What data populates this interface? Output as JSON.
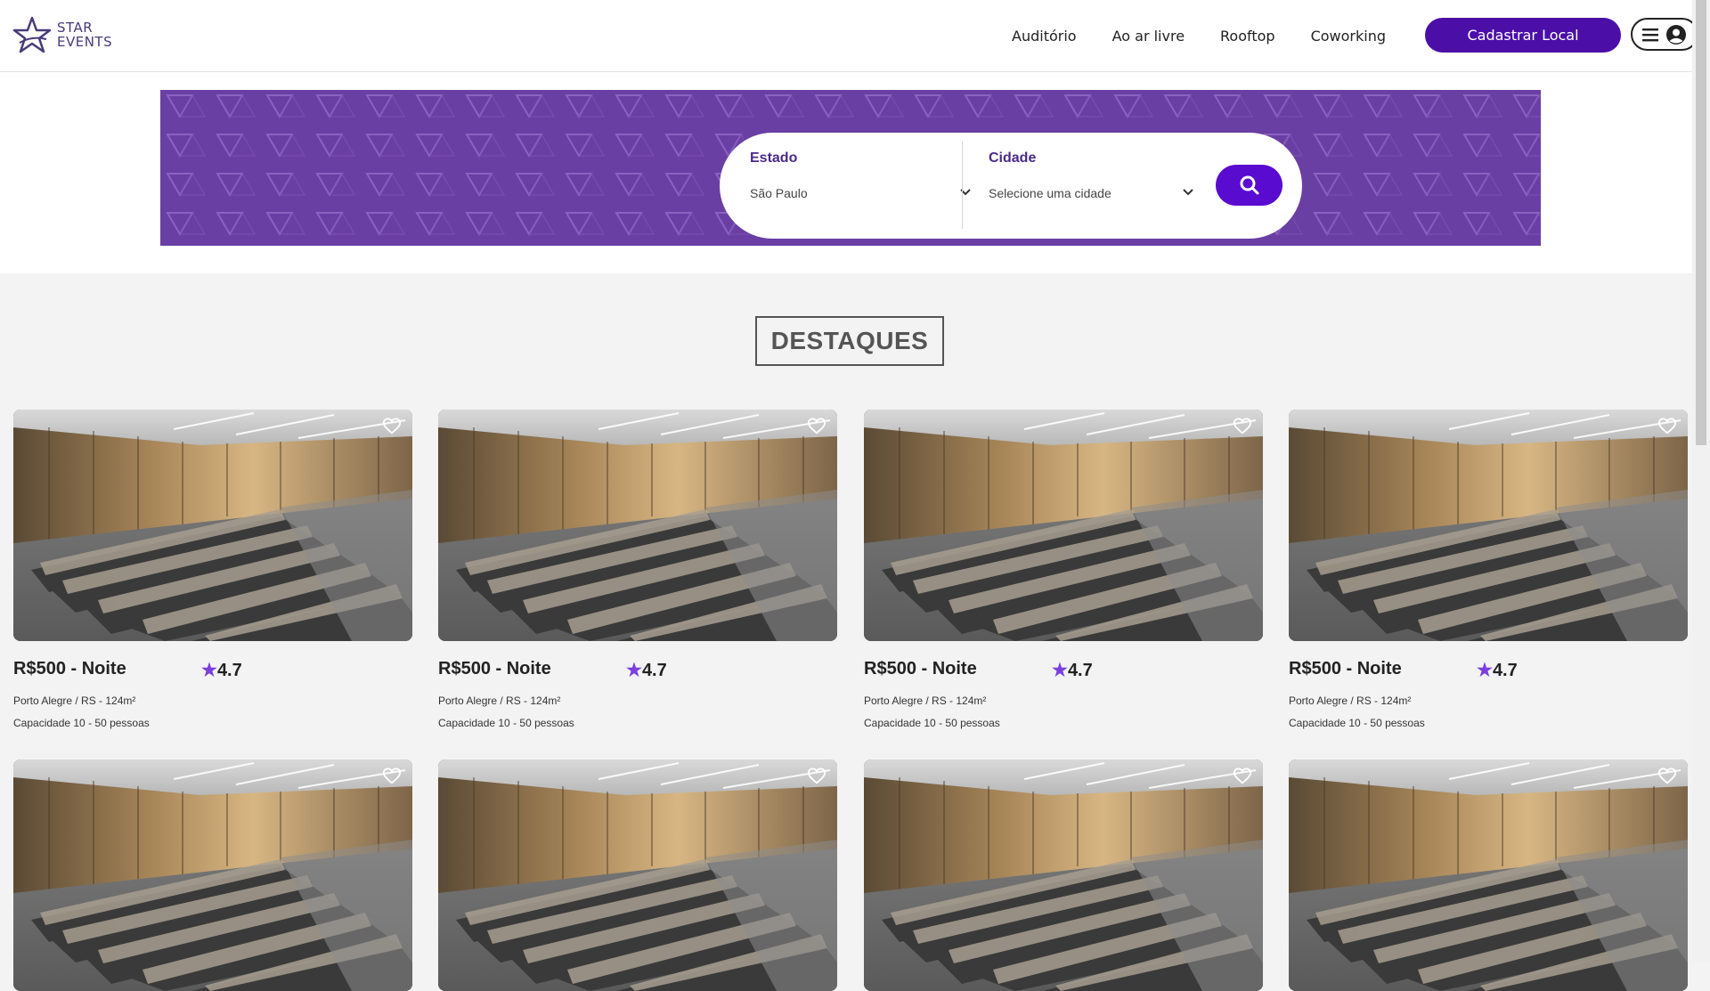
{
  "brand": {
    "line1": "STAR",
    "line2": "EVENTS"
  },
  "nav": {
    "items": [
      "Auditório",
      "Ao ar livre",
      "Rooftop",
      "Coworking"
    ],
    "cta": "Cadastrar Local"
  },
  "search": {
    "estado_label": "Estado",
    "estado_value": "São Paulo",
    "cidade_label": "Cidade",
    "cidade_value": "Selecione uma cidade"
  },
  "section_title": "DESTAQUES",
  "colors": {
    "primary": "#4b0fa8",
    "hero": "#6a3fa3",
    "star": "#7b3fe0"
  },
  "cards": [
    {
      "price": "R$500 - Noite",
      "rating": "4.7",
      "location": "Porto Alegre / RS - 124m²",
      "capacity": "Capacidade 10 - 50 pessoas"
    },
    {
      "price": "R$500 - Noite",
      "rating": "4.7",
      "location": "Porto Alegre / RS - 124m²",
      "capacity": "Capacidade 10 - 50 pessoas"
    },
    {
      "price": "R$500 - Noite",
      "rating": "4.7",
      "location": "Porto Alegre / RS - 124m²",
      "capacity": "Capacidade 10 - 50 pessoas"
    },
    {
      "price": "R$500 - Noite",
      "rating": "4.7",
      "location": "Porto Alegre / RS - 124m²",
      "capacity": "Capacidade 10 - 50 pessoas"
    },
    {
      "price": "",
      "rating": "",
      "location": "",
      "capacity": ""
    },
    {
      "price": "",
      "rating": "",
      "location": "",
      "capacity": ""
    },
    {
      "price": "",
      "rating": "",
      "location": "",
      "capacity": ""
    },
    {
      "price": "",
      "rating": "",
      "location": "",
      "capacity": ""
    }
  ]
}
